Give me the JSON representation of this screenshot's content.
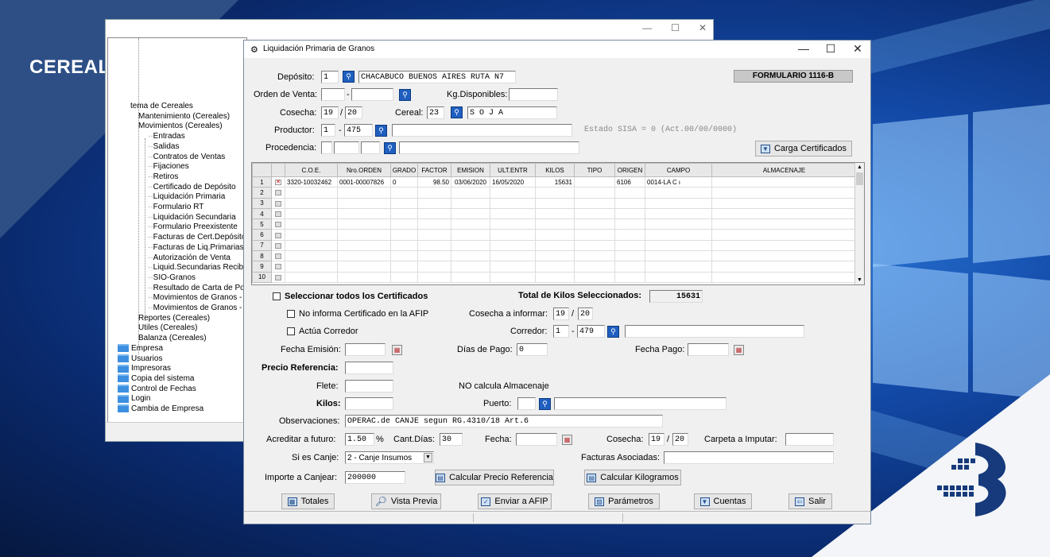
{
  "brand": {
    "title": "CEREALES"
  },
  "back_window": {
    "controls": [
      "—",
      "☐",
      "✕"
    ],
    "tree": [
      {
        "label": "tema de Cereales",
        "level": 1,
        "bold": false
      },
      {
        "label": "Mantenimiento (Cereales)",
        "level": 2
      },
      {
        "label": "Movimientos (Cereales)",
        "level": 2
      },
      {
        "label": "Entradas",
        "level": 3
      },
      {
        "label": "Salidas",
        "level": 3
      },
      {
        "label": "Contratos de Ventas",
        "level": 3
      },
      {
        "label": "Fijaciones",
        "level": 3
      },
      {
        "label": "Retiros",
        "level": 3
      },
      {
        "label": "Certificado de Depósito",
        "level": 3
      },
      {
        "label": "Liquidación Primaria",
        "level": 3
      },
      {
        "label": "Formulario RT",
        "level": 3
      },
      {
        "label": "Liquidación Secundaria",
        "level": 3
      },
      {
        "label": "Formulario Preexistente",
        "level": 3
      },
      {
        "label": "Facturas de Cert.Depósito",
        "level": 3
      },
      {
        "label": "Facturas de Liq.Primarias",
        "level": 3
      },
      {
        "label": "Autorización de Venta",
        "level": 3
      },
      {
        "label": "Liquid.Secundarias Recibi",
        "level": 3
      },
      {
        "label": "SIO-Granos",
        "level": 3
      },
      {
        "label": "Resultado de Carta de Po",
        "level": 3
      },
      {
        "label": "Movimientos de Granos -",
        "level": 3
      },
      {
        "label": "Movimientos de Granos -",
        "level": 3
      },
      {
        "label": "Reportes (Cereales)",
        "level": 2
      },
      {
        "label": "Utiles (Cereales)",
        "level": 2
      },
      {
        "label": "Balanza (Cereales)",
        "level": 2
      },
      {
        "label": "Empresa",
        "level": 0
      },
      {
        "label": "Usuarios",
        "level": 0
      },
      {
        "label": "Impresoras",
        "level": 0
      },
      {
        "label": "Copia del sistema",
        "level": 0
      },
      {
        "label": "Control de Fechas",
        "level": 0
      },
      {
        "label": "Login",
        "level": 0
      },
      {
        "label": "Cambia de Empresa",
        "level": 0
      }
    ]
  },
  "window": {
    "title": "Liquidación Primaria de Granos",
    "controls": {
      "min": "—",
      "max": "☐",
      "close": "✕"
    },
    "form_code": "FORMULARIO 1116-B"
  },
  "header": {
    "deposito_label": "Depósito:",
    "deposito_num": "1",
    "deposito_name": "CHACABUCO BUENOS AIRES RUTA N7",
    "orden_label": "Orden de Venta:",
    "orden_a": "",
    "orden_dash": "-",
    "orden_b": "",
    "kg_label": "Kg.Disponibles:",
    "kg_value": "",
    "cosecha_label": "Cosecha:",
    "cosecha_a": "19",
    "cosecha_sep": "/",
    "cosecha_b": "20",
    "cereal_label": "Cereal:",
    "cereal_num": "23",
    "cereal_name": "S O J A",
    "productor_label": "Productor:",
    "productor_a": "1",
    "productor_dash": "-",
    "productor_b": "475",
    "productor_name": "",
    "estado_sisa": "Estado SISA = 0    (Act.00/00/0000)",
    "procedencia_label": "Procedencia:",
    "procedencia_a": "",
    "procedencia_b": "",
    "procedencia_c": "",
    "procedencia_name": "",
    "carga_btn": "Carga Certificados"
  },
  "grid": {
    "columns": [
      "C.O.E.",
      "Nro.ORDEN",
      "GRADO",
      "FACTOR",
      "EMISION",
      "ULT.ENTR",
      "KILOS",
      "TIPO",
      "ORIGEN",
      "CAMPO",
      "ALMACENAJE"
    ],
    "rows": [
      {
        "n": "1",
        "checked": true,
        "cells": [
          "3320-10032462",
          "0001-00007826",
          "0",
          "98.50",
          "03/06/2020",
          "16/05/2020",
          "15631",
          "",
          "6106",
          "0014-LA C        ι",
          ""
        ]
      },
      {
        "n": "2",
        "checked": false,
        "cells": [
          "",
          "",
          "",
          "",
          "",
          "",
          "",
          "",
          "",
          "",
          ""
        ]
      },
      {
        "n": "3",
        "checked": false,
        "cells": [
          "",
          "",
          "",
          "",
          "",
          "",
          "",
          "",
          "",
          "",
          ""
        ]
      },
      {
        "n": "4",
        "checked": false,
        "cells": [
          "",
          "",
          "",
          "",
          "",
          "",
          "",
          "",
          "",
          "",
          ""
        ]
      },
      {
        "n": "5",
        "checked": false,
        "cells": [
          "",
          "",
          "",
          "",
          "",
          "",
          "",
          "",
          "",
          "",
          ""
        ]
      },
      {
        "n": "6",
        "checked": false,
        "cells": [
          "",
          "",
          "",
          "",
          "",
          "",
          "",
          "",
          "",
          "",
          ""
        ]
      },
      {
        "n": "7",
        "checked": false,
        "cells": [
          "",
          "",
          "",
          "",
          "",
          "",
          "",
          "",
          "",
          "",
          ""
        ]
      },
      {
        "n": "8",
        "checked": false,
        "cells": [
          "",
          "",
          "",
          "",
          "",
          "",
          "",
          "",
          "",
          "",
          ""
        ]
      },
      {
        "n": "9",
        "checked": false,
        "cells": [
          "",
          "",
          "",
          "",
          "",
          "",
          "",
          "",
          "",
          "",
          ""
        ]
      },
      {
        "n": "10",
        "checked": false,
        "cells": [
          "",
          "",
          "",
          "",
          "",
          "",
          "",
          "",
          "",
          "",
          ""
        ]
      }
    ]
  },
  "lower": {
    "select_all_label": "Seleccionar todos los Certificados",
    "total_label": "Total de Kilos Seleccionados:",
    "total_value": "15631",
    "no_informa_label": "No informa Certificado en la AFIP",
    "cosecha_inf_label": "Cosecha a informar:",
    "cosecha_inf_a": "19",
    "cosecha_inf_sep": "/",
    "cosecha_inf_b": "20",
    "actua_label": "Actúa Corredor",
    "corredor_label": "Corredor:",
    "corredor_a": "1",
    "corredor_dash": "-",
    "corredor_b": "479",
    "corredor_name": "",
    "fecha_emision_label": "Fecha Emisión:",
    "fecha_emision": "",
    "dias_pago_label": "Días de Pago:",
    "dias_pago": "0",
    "fecha_pago_label": "Fecha Pago:",
    "fecha_pago": "",
    "precio_ref_label": "Precio Referencia:",
    "precio_ref": "",
    "flete_label": "Flete:",
    "flete": "",
    "no_calcula": "NO calcula Almacenaje",
    "kilos_label": "Kilos:",
    "kilos": "",
    "puerto_label": "Puerto:",
    "puerto_a": "",
    "puerto_name": "",
    "observ_label": "Observaciones:",
    "observ": "OPERAC.de CANJE segun RG.4310/18 Art.6",
    "acreditar_label": "Acreditar a futuro:",
    "acreditar": "1.50",
    "pct": "%",
    "cant_dias_label": "Cant.Días:",
    "cant_dias": "30",
    "fecha_label": "Fecha:",
    "fecha": "",
    "cosecha2_label": "Cosecha:",
    "cosecha2_a": "19",
    "cosecha2_sep": "/",
    "cosecha2_b": "20",
    "carpeta_label": "Carpeta a Imputar:",
    "carpeta": "",
    "canje_label": "Si es Canje:",
    "canje_value": "2 - Canje Insumos",
    "facturas_label": "Facturas Asociadas:",
    "facturas": "",
    "importe_label": "Importe a Canjear:",
    "importe": "200000",
    "calc_precio_btn": "Calcular Precio Referencia",
    "calc_kilos_btn": "Calcular Kilogramos"
  },
  "footer_buttons": {
    "totales": "Totales",
    "vista_previa": "Vista Previa",
    "enviar_afip": "Enviar a AFIP",
    "parametros": "Parámetros",
    "cuentas": "Cuentas",
    "salir": "Salir"
  }
}
